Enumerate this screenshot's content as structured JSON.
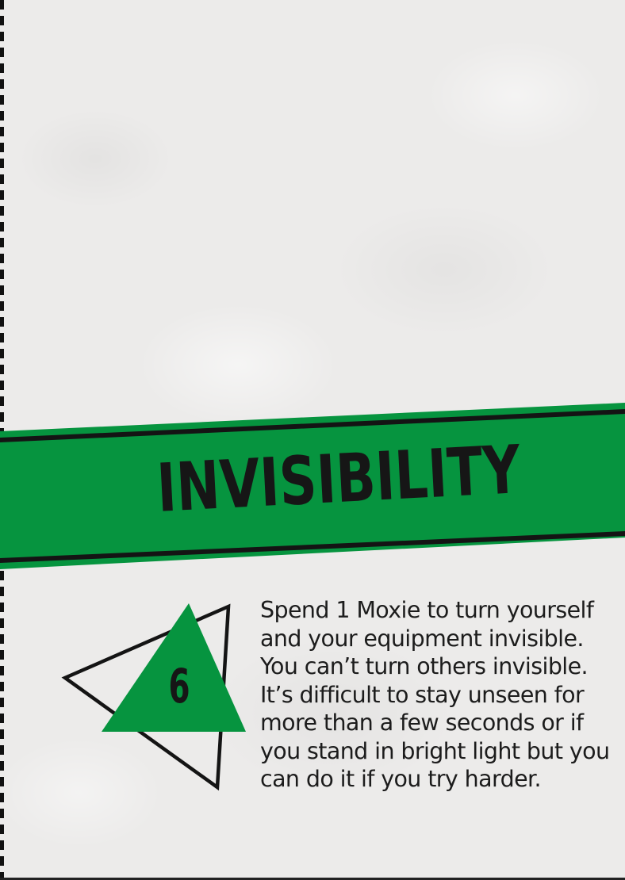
{
  "card": {
    "title": "INVISIBILITY",
    "cost": "6",
    "description": "Spend 1 Moxie to turn yourself and your equipment invisible. You can’t turn others invisible. It’s difficult to stay unseen for more than a few seconds or if you stand in bright light but you can do it if you try harder.",
    "colors": {
      "banner_green": "#06943f",
      "ink": "#161616",
      "paper": "#ecebea"
    },
    "icons": {
      "cost_badge": "overlapping-triangles-icon"
    }
  }
}
